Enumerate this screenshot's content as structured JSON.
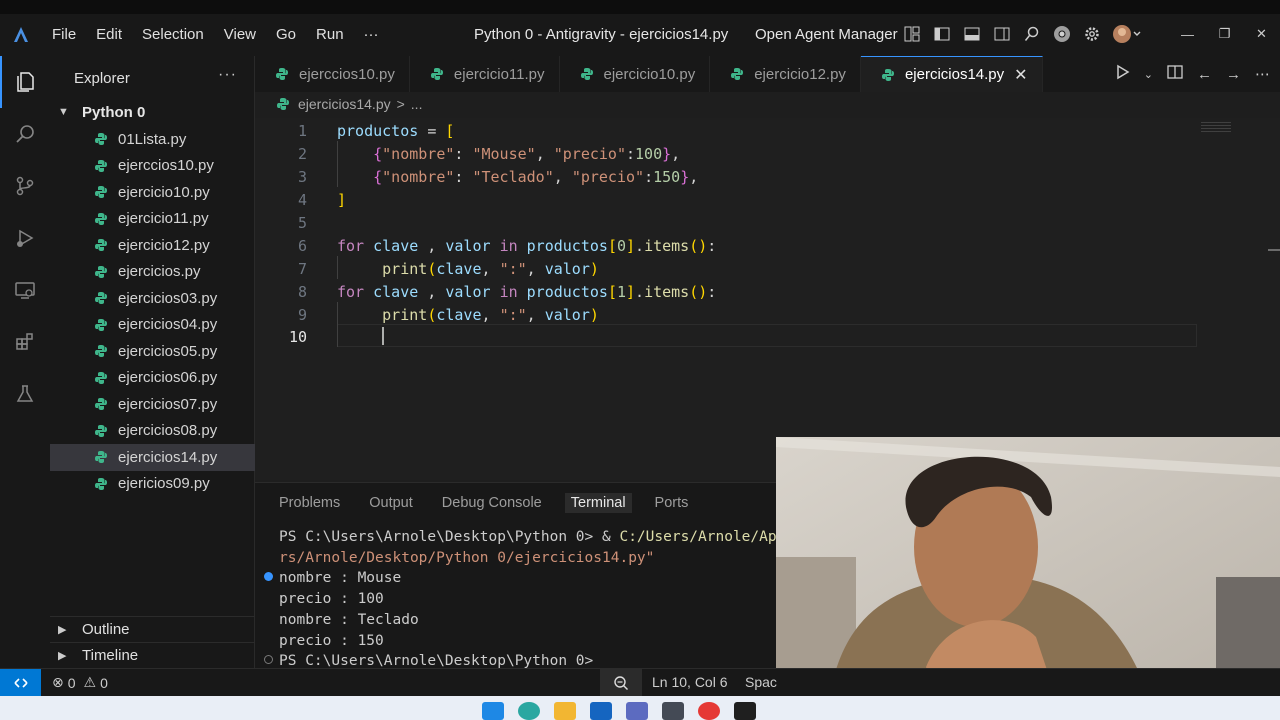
{
  "app": {
    "window_title": "Python 0 - Antigravity - ejercicios14.py",
    "agent_manager": "Open Agent Manager"
  },
  "menu": [
    "File",
    "Edit",
    "Selection",
    "View",
    "Go",
    "Run",
    "···"
  ],
  "sidebar": {
    "title": "Explorer",
    "more": "···",
    "folder": "Python 0",
    "files": [
      "01Lista.py",
      "ejerccios10.py",
      "ejercicio10.py",
      "ejercicio11.py",
      "ejercicio12.py",
      "ejercicios.py",
      "ejercicios03.py",
      "ejercicios04.py",
      "ejercicios05.py",
      "ejercicios06.py",
      "ejercicios07.py",
      "ejercicios08.py",
      "ejercicios14.py",
      "ejericios09.py"
    ],
    "selected_file": "ejercicios14.py",
    "outline": "Outline",
    "timeline": "Timeline"
  },
  "tabs": [
    {
      "label": "ejerccios10.py"
    },
    {
      "label": "ejercicio11.py"
    },
    {
      "label": "ejercicio10.py"
    },
    {
      "label": "ejercicio12.py"
    },
    {
      "label": "ejercicios14.py",
      "active": true
    }
  ],
  "breadcrumb": {
    "file": "ejercicios14.py",
    "sep": ">",
    "more": "..."
  },
  "editor": {
    "line_numbers": [
      "1",
      "2",
      "3",
      "4",
      "5",
      "6",
      "7",
      "8",
      "9",
      "10"
    ],
    "current_line": "10"
  },
  "panel": {
    "tabs": [
      "Problems",
      "Output",
      "Debug Console",
      "Terminal",
      "Ports"
    ],
    "active_tab": "Terminal",
    "terminal": {
      "line1_prompt": "PS C:\\Users\\Arnole\\Desktop\\Python 0> & ",
      "line1_path": "C:/Users/Arnole/Ap",
      "line2": "rs/Arnole/Desktop/Python 0/ejercicios14.py\"",
      "line3": "nombre : Mouse",
      "line4": "precio : 100",
      "line5": "nombre : Teclado",
      "line6": "precio : 150",
      "line7": "PS C:\\Users\\Arnole\\Desktop\\Python 0>"
    }
  },
  "statusbar": {
    "errors": "0",
    "warnings": "0",
    "position": "Ln 10, Col 6",
    "spaces": "Spac"
  },
  "colors": {
    "accent": "#3794ff",
    "remote": "#0078d4",
    "python_icon": "#3fb68b"
  }
}
